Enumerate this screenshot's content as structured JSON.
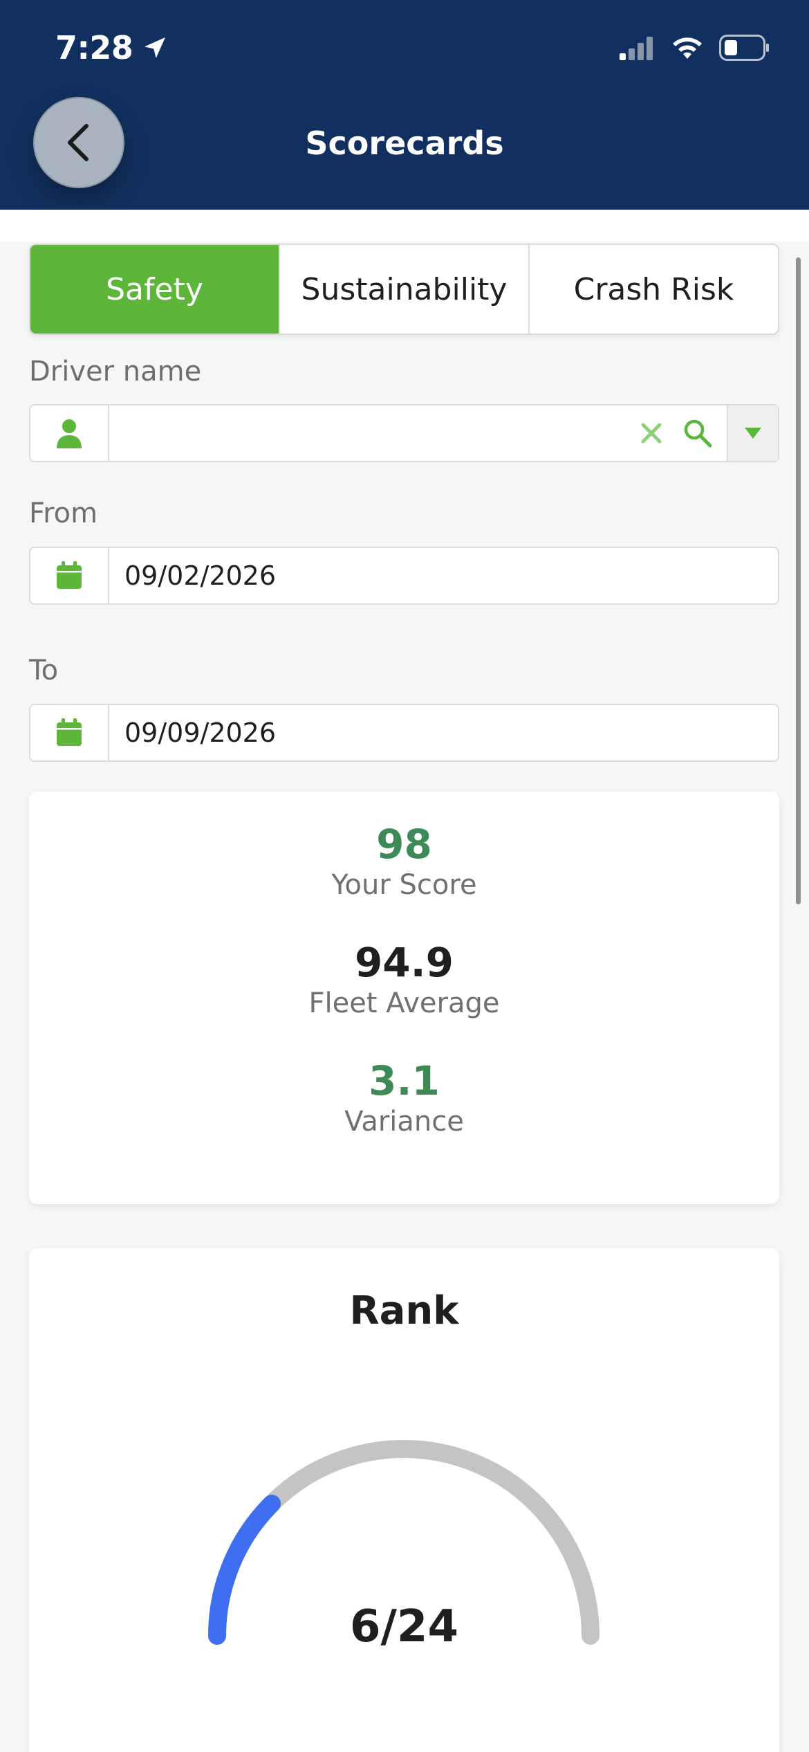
{
  "status": {
    "time": "7:28"
  },
  "header": {
    "title": "Scorecards"
  },
  "tabs": [
    {
      "label": "Safety",
      "active": true
    },
    {
      "label": "Sustainability",
      "active": false
    },
    {
      "label": "Crash Risk",
      "active": false
    }
  ],
  "filters": {
    "driver_label": "Driver name",
    "driver_value": "",
    "from_label": "From",
    "from_value": "09/02/2026",
    "to_label": "To",
    "to_value": "09/09/2026"
  },
  "scores": {
    "your_score": "98",
    "your_score_label": "Your Score",
    "fleet_average": "94.9",
    "fleet_average_label": "Fleet Average",
    "variance": "3.1",
    "variance_label": "Variance"
  },
  "rank": {
    "title": "Rank",
    "display": "6/24",
    "position": 6,
    "total": 24
  },
  "colors": {
    "header_bg": "#12305f",
    "accent_green": "#5db63a",
    "score_green": "#3d8a57",
    "gauge_fill": "#3f6ef0",
    "gauge_track": "#c4c4c4"
  }
}
